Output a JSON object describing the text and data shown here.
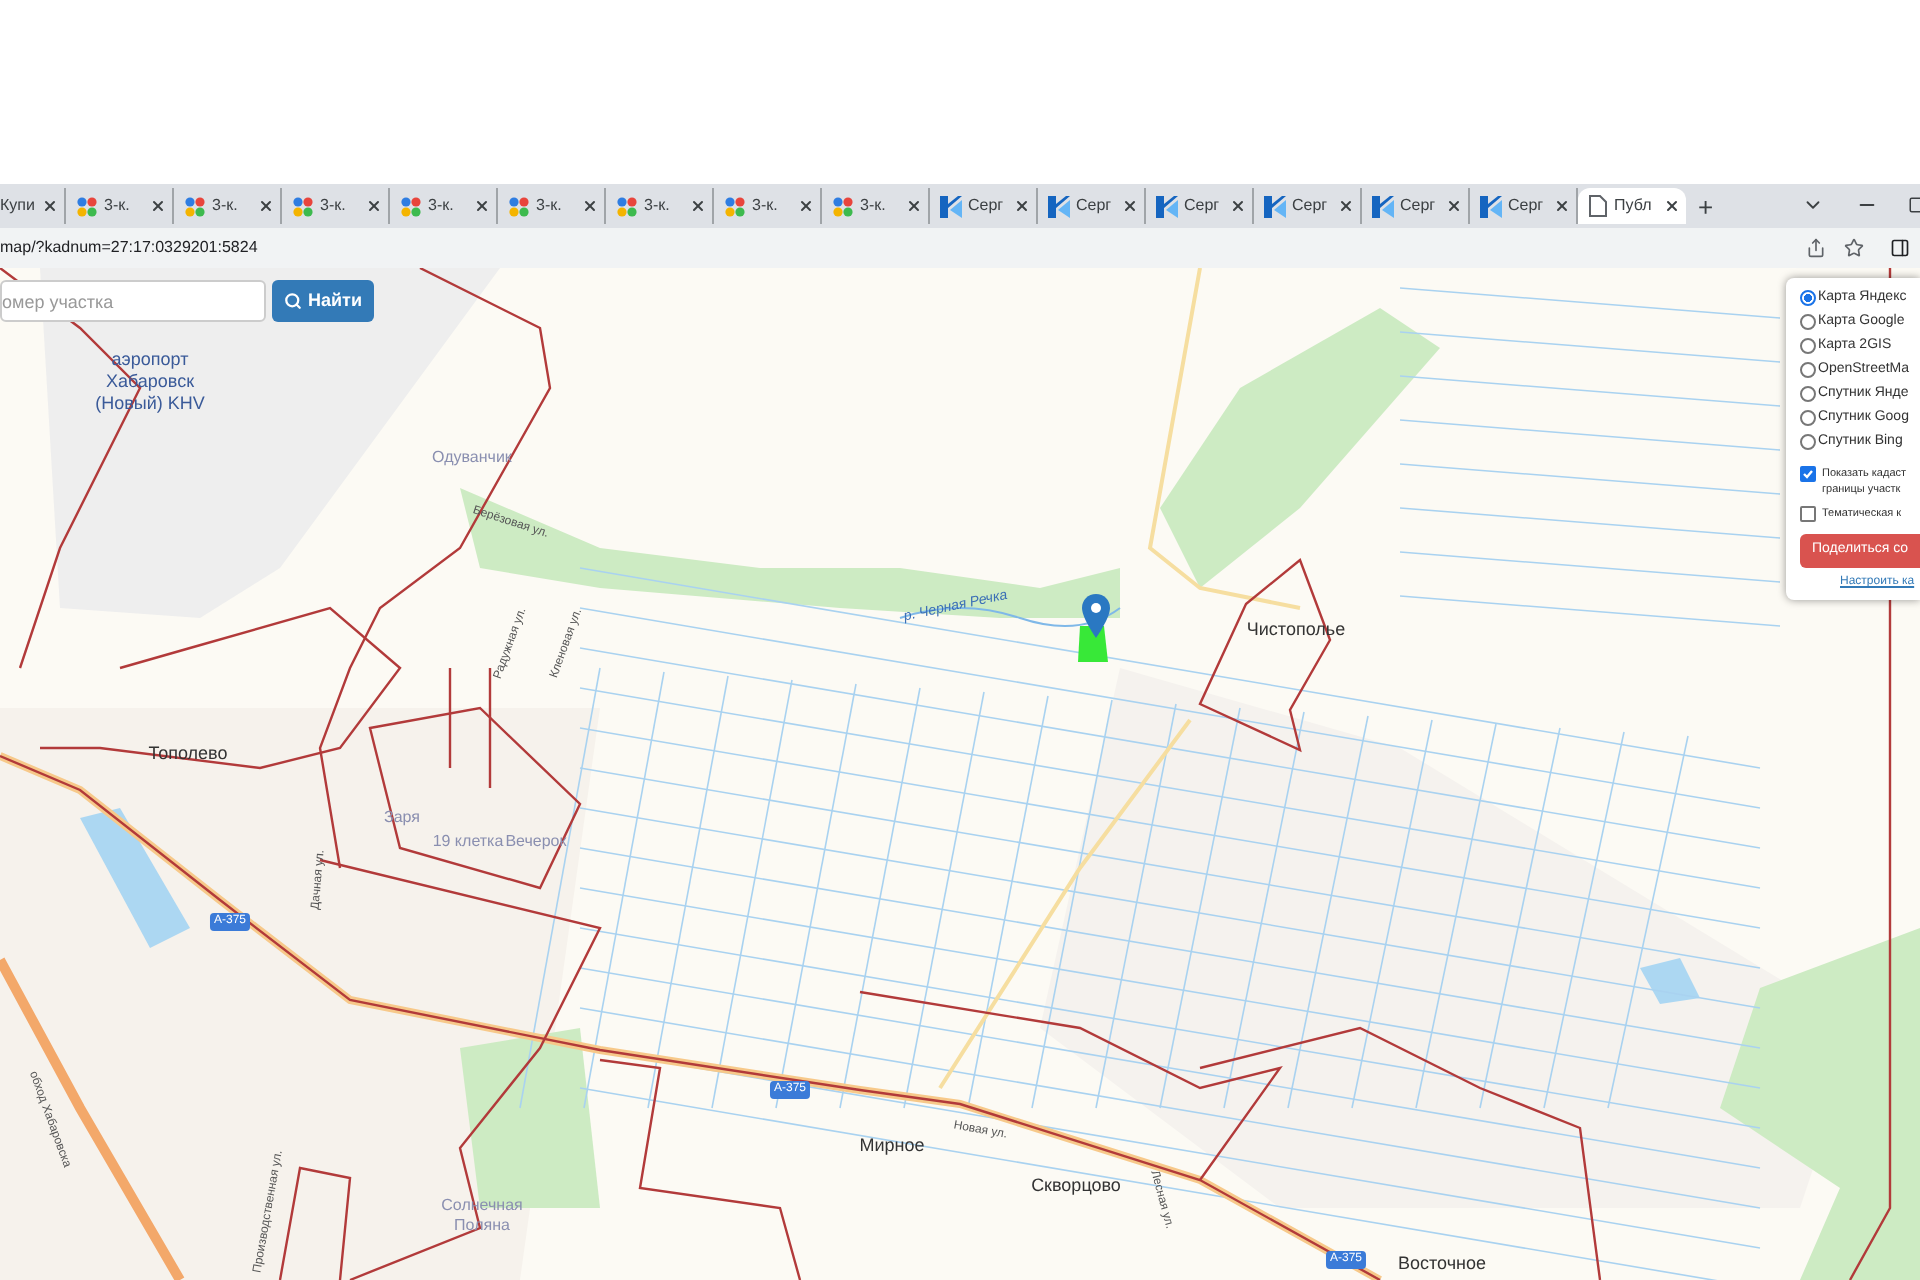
{
  "tabs": [
    {
      "title": "Купи",
      "kind": "plain",
      "selected": false
    },
    {
      "title": "3-к.",
      "kind": "dots",
      "selected": false
    },
    {
      "title": "3-к.",
      "kind": "dots",
      "selected": false
    },
    {
      "title": "3-к.",
      "kind": "dots",
      "selected": false
    },
    {
      "title": "3-к.",
      "kind": "dots",
      "selected": false
    },
    {
      "title": "3-к.",
      "kind": "dots",
      "selected": false
    },
    {
      "title": "3-к.",
      "kind": "dots",
      "selected": false
    },
    {
      "title": "3-к.",
      "kind": "dots",
      "selected": false
    },
    {
      "title": "3-к.",
      "kind": "dots",
      "selected": false
    },
    {
      "title": "Серг",
      "kind": "k",
      "selected": false
    },
    {
      "title": "Серг",
      "kind": "k",
      "selected": false
    },
    {
      "title": "Серг",
      "kind": "k",
      "selected": false
    },
    {
      "title": "Серг",
      "kind": "k",
      "selected": false
    },
    {
      "title": "Серг",
      "kind": "k",
      "selected": false
    },
    {
      "title": "Серг",
      "kind": "k",
      "selected": false
    },
    {
      "title": "Публ",
      "kind": "doc",
      "selected": true
    }
  ],
  "new_tab": "+",
  "address": "map/?kadnum=27:17:0329201:5824",
  "search": {
    "placeholder": "омер участка",
    "button": "Найти"
  },
  "layers": {
    "options": [
      {
        "label": "Карта Яндекс",
        "selected": true
      },
      {
        "label": "Карта Google",
        "selected": false
      },
      {
        "label": "Карта 2GIS",
        "selected": false
      },
      {
        "label": "OpenStreetMa",
        "selected": false
      },
      {
        "label": "Спутник Янде",
        "selected": false
      },
      {
        "label": "Спутник Goog",
        "selected": false
      },
      {
        "label": "Спутник Bing",
        "selected": false
      }
    ],
    "toggles": [
      {
        "label": "Показать кадаст границы участк",
        "checked": true
      },
      {
        "label": "Тематическая к",
        "checked": false
      }
    ],
    "share_button": "Поделиться со",
    "settings_link": "Настроить ка"
  },
  "map_labels": [
    {
      "text": "аэропорт Хабаровск (Новый) KHV",
      "kind": "airport"
    },
    {
      "text": "Одуванчик",
      "kind": "area"
    },
    {
      "text": "Берёзовая ул.",
      "kind": "street"
    },
    {
      "text": "Радужная ул.",
      "kind": "street"
    },
    {
      "text": "Кленовая ул.",
      "kind": "street"
    },
    {
      "text": "р. Черная Речка",
      "kind": "river"
    },
    {
      "text": "Чистополье",
      "kind": "place"
    },
    {
      "text": "Тополево",
      "kind": "place"
    },
    {
      "text": "Заря",
      "kind": "area"
    },
    {
      "text": "19 клетка",
      "kind": "area"
    },
    {
      "text": "Вечерок",
      "kind": "area"
    },
    {
      "text": "A-375",
      "kind": "badge"
    },
    {
      "text": "Дачная ул.",
      "kind": "street"
    },
    {
      "text": "обход Хабаровска",
      "kind": "street"
    },
    {
      "text": "A-375",
      "kind": "badge"
    },
    {
      "text": "Мирное",
      "kind": "place"
    },
    {
      "text": "Новая ул.",
      "kind": "street"
    },
    {
      "text": "Скворцово",
      "kind": "place"
    },
    {
      "text": "Лесная ул.",
      "kind": "street"
    },
    {
      "text": "Солнечная Поляна",
      "kind": "area"
    },
    {
      "text": "Производственная ул.",
      "kind": "street"
    },
    {
      "text": "A-375",
      "kind": "badge"
    },
    {
      "text": "Восточное",
      "kind": "place"
    }
  ]
}
